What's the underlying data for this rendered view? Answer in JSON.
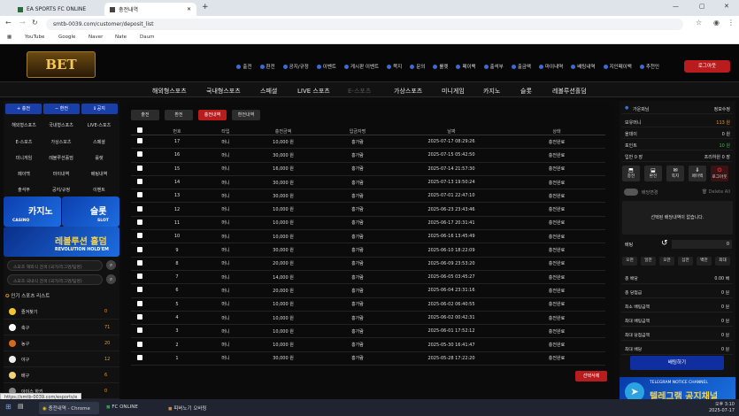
{
  "browser": {
    "tabs": [
      {
        "title": "EA SPORTS FC ONLINE"
      },
      {
        "title": "충전내역"
      }
    ],
    "url": "smtb-0039.com/customer/deposit_list",
    "bookmarks": [
      "YouTube",
      "Google",
      "Naver",
      "Nate",
      "Daum"
    ],
    "status_url": "https://smtb-0039.com/esports/e"
  },
  "site": {
    "logo": "BET",
    "top_nav": [
      "출전",
      "환전",
      "공지/규정",
      "이벤트",
      "게시판 이벤트",
      "쪽지",
      "문의",
      "룰렛",
      "페이백",
      "출석부",
      "출금액",
      "마이내역",
      "배팅내역",
      "지인페이백",
      "추천인"
    ],
    "logout": "로그아웃",
    "main_nav": [
      "해외형스포츠",
      "국내형스포츠",
      "스페셜",
      "LIVE 스포츠",
      "E-스포츠",
      "가상스포츠",
      "미니게임",
      "카지노",
      "슬롯",
      "레볼루션홀덤"
    ]
  },
  "sidebar": {
    "actions": [
      "충전",
      "환전",
      "공지"
    ],
    "grid": [
      "해외형스포츠",
      "국내형스포츠",
      "LIVE-스포츠",
      "E-스포츠",
      "가상스포츠",
      "스페셜",
      "미니게임",
      "레볼루션홀덤",
      "룰렛",
      "페이백",
      "마이내역",
      "배팅내역",
      "출석부",
      "공지/규정",
      "이벤트"
    ],
    "banners": {
      "casino": "카지노",
      "casino_sub": "CASINO",
      "slot": "슬롯",
      "slot_sub": "SLOT",
      "holdem": "레볼루션 홀덤",
      "holdem_sub": "REVOLUTION HOLD'EM"
    },
    "search_overseas": "스포츠 해외식 검색 (국가/리그명/팀명)",
    "search_domestic": "스포츠 국내식 검색 (국가/리그명/팀명)",
    "popular_title": "인기 스포츠 리스트",
    "sports": [
      {
        "name": "즐겨찾기",
        "count": "0"
      },
      {
        "name": "축구",
        "count": "71"
      },
      {
        "name": "농구",
        "count": "20"
      },
      {
        "name": "야구",
        "count": "12"
      },
      {
        "name": "배구",
        "count": "6"
      },
      {
        "name": "아이스 하키",
        "count": "0"
      }
    ]
  },
  "content": {
    "subtabs": [
      "출전",
      "환전",
      "충전내역",
      "환전내역"
    ],
    "columns": [
      "번호",
      "타입",
      "충전금액",
      "입금자명",
      "날짜",
      "상태"
    ],
    "rows": [
      {
        "no": "17",
        "type": "머니",
        "amount": "10,000 원",
        "name": "홍가람",
        "date": "2025-07-17 08:29:26",
        "status": "충전완료"
      },
      {
        "no": "16",
        "type": "머니",
        "amount": "30,000 원",
        "name": "홍가람",
        "date": "2025-07-15 05:42:50",
        "status": "충전완료"
      },
      {
        "no": "15",
        "type": "머니",
        "amount": "16,000 원",
        "name": "홍가람",
        "date": "2025-07-14 21:57:30",
        "status": "충전완료"
      },
      {
        "no": "14",
        "type": "머니",
        "amount": "30,000 원",
        "name": "홍가람",
        "date": "2025-07-13 19:50:24",
        "status": "충전완료"
      },
      {
        "no": "13",
        "type": "머니",
        "amount": "30,000 원",
        "name": "홍가람",
        "date": "2025-07-01 22:47:10",
        "status": "충전완료"
      },
      {
        "no": "12",
        "type": "머니",
        "amount": "10,000 원",
        "name": "홍가람",
        "date": "2025-06-23 23:43:46",
        "status": "충전완료"
      },
      {
        "no": "11",
        "type": "머니",
        "amount": "10,000 원",
        "name": "홍가람",
        "date": "2025-06-17 20:31:41",
        "status": "충전완료"
      },
      {
        "no": "10",
        "type": "머니",
        "amount": "10,000 원",
        "name": "홍가람",
        "date": "2025-06-16 13:45:49",
        "status": "충전완료"
      },
      {
        "no": "9",
        "type": "머니",
        "amount": "30,000 원",
        "name": "홍가람",
        "date": "2025-06-10 18:22:09",
        "status": "충전완료"
      },
      {
        "no": "8",
        "type": "머니",
        "amount": "20,000 원",
        "name": "홍가람",
        "date": "2025-06-09 23:53:20",
        "status": "충전완료"
      },
      {
        "no": "7",
        "type": "머니",
        "amount": "14,000 원",
        "name": "홍가람",
        "date": "2025-06-05 03:45:27",
        "status": "충전완료"
      },
      {
        "no": "6",
        "type": "머니",
        "amount": "20,000 원",
        "name": "홍가람",
        "date": "2025-06-04 23:31:16",
        "status": "충전완료"
      },
      {
        "no": "5",
        "type": "머니",
        "amount": "10,000 원",
        "name": "홍가람",
        "date": "2025-06-02 06:40:55",
        "status": "충전완료"
      },
      {
        "no": "4",
        "type": "머니",
        "amount": "10,000 원",
        "name": "홍가람",
        "date": "2025-06-02 00:42:31",
        "status": "충전완료"
      },
      {
        "no": "3",
        "type": "머니",
        "amount": "10,000 원",
        "name": "홍가람",
        "date": "2025-06-01 17:52:12",
        "status": "충전완료"
      },
      {
        "no": "2",
        "type": "머니",
        "amount": "10,000 원",
        "name": "홍가람",
        "date": "2025-05-30 16:41:47",
        "status": "충전완료"
      },
      {
        "no": "1",
        "type": "머니",
        "amount": "30,000 원",
        "name": "홍가람",
        "date": "2025-05-28 17:22:20",
        "status": "충전완료"
      }
    ],
    "delete_selected": "선택삭제"
  },
  "right_panel": {
    "username": "가운뵈님",
    "profile_link": "정보수정",
    "balances": [
      {
        "label": "보유머니",
        "value": "113 원"
      },
      {
        "label": "올데이",
        "value": "0 원"
      },
      {
        "label": "포인트",
        "value": "10 원"
      },
      {
        "label": "입반 0 장",
        "value": "프리하원 0 장"
      }
    ],
    "quick": [
      "충전",
      "환전",
      "쪽지",
      "페이백",
      "로그아웃"
    ],
    "odds_toggle": "배당변경",
    "delete_all": "Delete All",
    "empty_msg": "선택된 배당내역이 없습니다.",
    "bet_label": "배팅",
    "bet_value": "0",
    "chips": [
      "오천",
      "일만",
      "오만",
      "십만",
      "백만",
      "최대"
    ],
    "bet_rows": [
      {
        "label": "총 배당",
        "value": "0.00 배"
      },
      {
        "label": "총 당첨금",
        "value": "0 원"
      },
      {
        "label": "최소 배팅금액",
        "value": "0 원"
      },
      {
        "label": "최대 배팅금액",
        "value": "0 원"
      },
      {
        "label": "최대 당첨금액",
        "value": "0 원"
      },
      {
        "label": "최대 배당",
        "value": "0 원"
      }
    ],
    "bet_button": "배팅하기",
    "telegram_small": "TELEGRAM NOTICE CHANNEL",
    "telegram_title": "텔레그램 공지채널"
  },
  "taskbar": {
    "items": [
      "충전내역 - Chrome",
      "FC ONLINE",
      "피버노기 오바링"
    ],
    "time": "오후 3:10",
    "date": "2025-07-17"
  }
}
